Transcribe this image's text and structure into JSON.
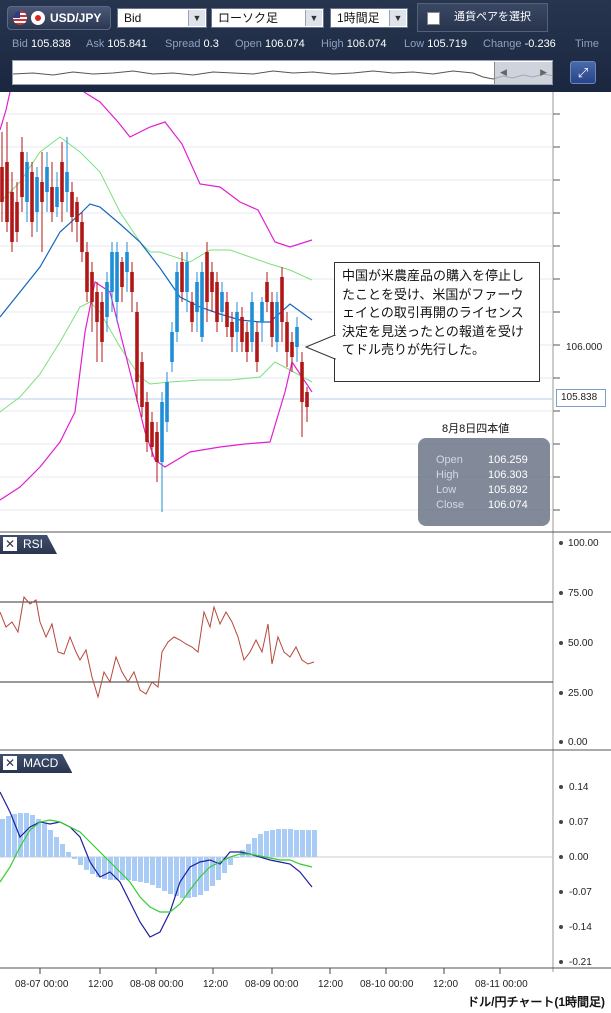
{
  "toolbar": {
    "pair": "USD/JPY",
    "price_type": "Bid",
    "chart_style": "ローソク足",
    "timeframe": "1時間足",
    "select_pair": "通貨ペアを選択"
  },
  "quote": [
    {
      "label": "Bid",
      "value": "105.838"
    },
    {
      "label": "Ask",
      "value": "105.841"
    },
    {
      "label": "Spread",
      "value": "0.3"
    },
    {
      "label": "Open",
      "value": "106.074"
    },
    {
      "label": "High",
      "value": "106.074"
    },
    {
      "label": "Low",
      "value": "105.719"
    },
    {
      "label": "Change",
      "value": "-0.236"
    },
    {
      "label": "Time",
      "value": ""
    }
  ],
  "main_chart": {
    "price_label": "106.000",
    "current_price": "105.838",
    "annotation": "中国が米農産品の購入を停止したことを受け、米国がファーウェイとの取引再開のライセンス決定を見送ったとの報道を受けてドル売りが先行した。",
    "ohlc_title": "8月8日四本値",
    "ohlc": [
      {
        "label": "Open",
        "value": "106.259"
      },
      {
        "label": "High",
        "value": "106.303"
      },
      {
        "label": "Low",
        "value": "105.892"
      },
      {
        "label": "Close",
        "value": "106.074"
      }
    ]
  },
  "rsi_panel": {
    "title": "RSI",
    "ticks": [
      "100.00",
      "75.00",
      "50.00",
      "25.00",
      "0.00"
    ]
  },
  "macd_panel": {
    "title": "MACD",
    "ticks": [
      "0.14",
      "0.07",
      "0.00",
      "-0.07",
      "-0.14",
      "-0.21"
    ]
  },
  "x_axis": {
    "labels": [
      "08-07 00:00",
      "12:00",
      "08-08 00:00",
      "12:00",
      "08-09 00:00",
      "12:00",
      "08-10 00:00",
      "12:00",
      "08-11 00:00"
    ]
  },
  "footer": {
    "title": "ドル/円チャート(1時間足)"
  },
  "colors": {
    "candle_up": "#1e8fd6",
    "candle_down": "#b01818",
    "bollinger_outer": "#e21fd0",
    "bollinger_inner": "#7de07a",
    "moving_average": "#1565c0",
    "rsi_line": "#b5473a",
    "macd_line": "#1f1fa0",
    "signal_line": "#33cc33",
    "histogram": "#a8ccf5"
  }
}
